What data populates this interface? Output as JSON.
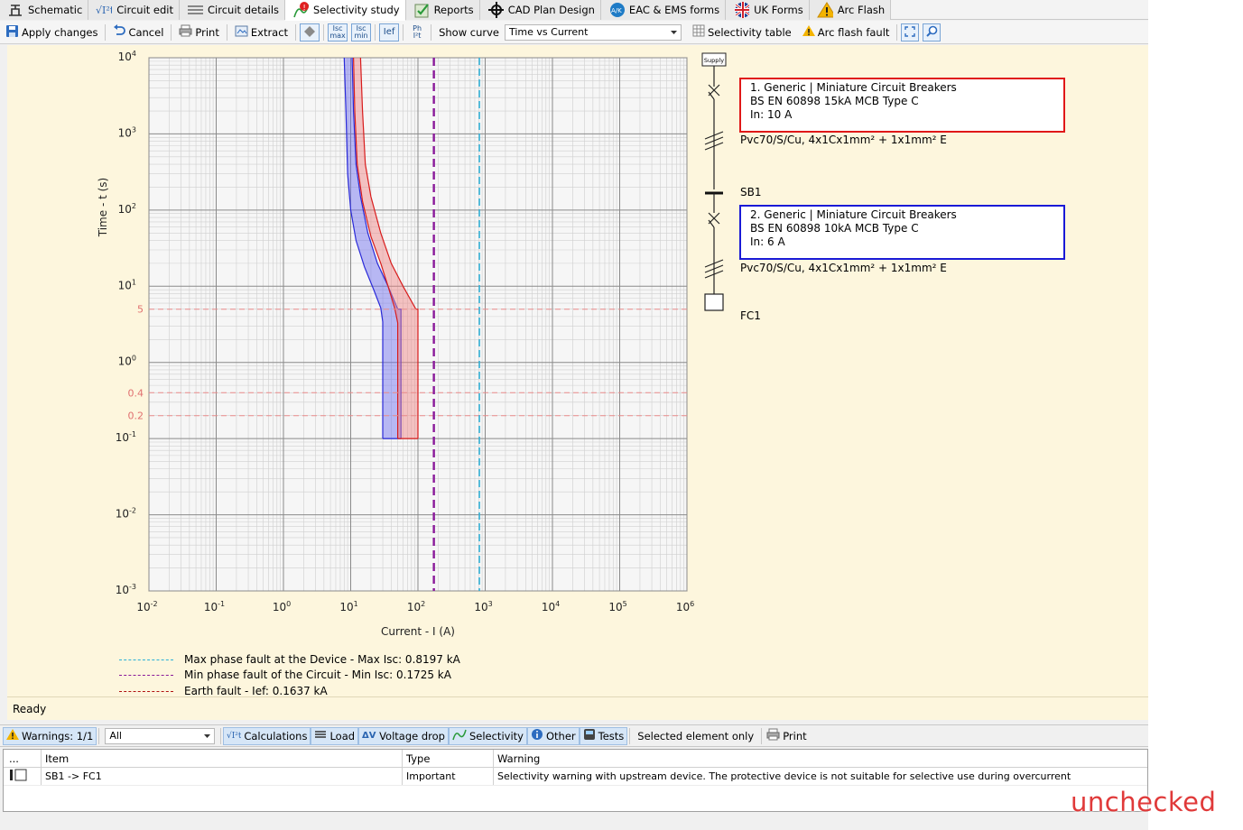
{
  "tabs": [
    {
      "label": "Schematic",
      "icon": "schematic-icon",
      "active": false
    },
    {
      "label": "Circuit edit",
      "icon": "formula-icon",
      "active": false
    },
    {
      "label": "Circuit details",
      "icon": "lines-icon",
      "active": false
    },
    {
      "label": "Selectivity study",
      "icon": "warning-badge-icon",
      "active": true
    },
    {
      "label": "Reports",
      "icon": "checked-doc-icon",
      "active": false
    },
    {
      "label": "CAD Plan Design",
      "icon": "crosshair-icon",
      "active": false
    },
    {
      "label": "EAC & EMS forms",
      "icon": "globe-icon",
      "active": false
    },
    {
      "label": "UK Forms",
      "icon": "uk-flag-icon",
      "active": false
    },
    {
      "label": "Arc Flash",
      "icon": "arc-warning-icon",
      "active": false
    }
  ],
  "toolbar": {
    "apply": "Apply changes",
    "cancel": "Cancel",
    "print": "Print",
    "extract": "Extract",
    "isc_max_top": "Isc",
    "isc_max_bottom": "max",
    "isc_min_top": "Isc",
    "isc_min_bottom": "min",
    "ief": "Ief",
    "ph_top": "Ph",
    "ph_bottom": "I²t",
    "show_curve_label": "Show curve",
    "show_curve_value": "Time vs Current",
    "selectivity_table": "Selectivity table",
    "arc_flash_fault": "Arc flash fault"
  },
  "chart_data": {
    "type": "line",
    "x_scale": "log",
    "y_scale": "log",
    "xlim": [
      0.01,
      1000000
    ],
    "ylim": [
      0.001,
      10000
    ],
    "xlabel": "Current - I (A)",
    "ylabel": "Time - t (s)",
    "x_ticks": [
      {
        "base": "10",
        "exp": "-2"
      },
      {
        "base": "10",
        "exp": "-1"
      },
      {
        "base": "10",
        "exp": "0"
      },
      {
        "base": "10",
        "exp": "1"
      },
      {
        "base": "10",
        "exp": "2"
      },
      {
        "base": "10",
        "exp": "3"
      },
      {
        "base": "10",
        "exp": "4"
      },
      {
        "base": "10",
        "exp": "5"
      },
      {
        "base": "10",
        "exp": "6"
      }
    ],
    "y_ticks": [
      {
        "base": "10",
        "exp": "4"
      },
      {
        "base": "10",
        "exp": "3"
      },
      {
        "base": "10",
        "exp": "2"
      },
      {
        "base": "10",
        "exp": "1"
      },
      {
        "base": "10",
        "exp": "0"
      },
      {
        "base": "10",
        "exp": "-1"
      },
      {
        "base": "10",
        "exp": "-2"
      },
      {
        "base": "10",
        "exp": "-3"
      }
    ],
    "time_markers": [
      {
        "value": 5,
        "label": "5"
      },
      {
        "value": 0.4,
        "label": "0.4"
      },
      {
        "value": 0.2,
        "label": "0.2"
      }
    ],
    "vertical_markers": [
      {
        "name": "Max phase fault at the Device",
        "value": 819.7,
        "color": "#2bb0d8"
      },
      {
        "name": "Min phase fault of the Circuit",
        "value": 172.5,
        "color": "#8a1a9a"
      },
      {
        "name": "Earth fault",
        "value": 163.7,
        "color": "#b01010"
      }
    ],
    "series": [
      {
        "name": "",
        "color": "#2a2ad8",
        "fill": "#6b6bf0",
        "left": [
          [
            8,
            10000
          ],
          [
            8.5,
            2000
          ],
          [
            9,
            300
          ],
          [
            10,
            100
          ],
          [
            12,
            40
          ],
          [
            16,
            18
          ],
          [
            22,
            9
          ],
          [
            28,
            5.2
          ],
          [
            30,
            3.4
          ],
          [
            30,
            0.1
          ]
        ],
        "right": [
          [
            10.5,
            10000
          ],
          [
            11,
            2000
          ],
          [
            12,
            400
          ],
          [
            14,
            150
          ],
          [
            18,
            50
          ],
          [
            25,
            20
          ],
          [
            36,
            10
          ],
          [
            50,
            5
          ],
          [
            56,
            5
          ],
          [
            56,
            0.1
          ]
        ]
      },
      {
        "name": "",
        "color": "#d81c1c",
        "fill": "#f08080",
        "left": [
          [
            11,
            10000
          ],
          [
            11.5,
            2000
          ],
          [
            12.5,
            400
          ],
          [
            15,
            130
          ],
          [
            20,
            45
          ],
          [
            28,
            20
          ],
          [
            36,
            10
          ],
          [
            45,
            5.2
          ],
          [
            50,
            3.3
          ],
          [
            50,
            0.1
          ]
        ],
        "right": [
          [
            14,
            10000
          ],
          [
            15,
            2000
          ],
          [
            16.5,
            400
          ],
          [
            20,
            150
          ],
          [
            28,
            50
          ],
          [
            40,
            20
          ],
          [
            60,
            10
          ],
          [
            93,
            5
          ],
          [
            100,
            5
          ],
          [
            100,
            0.1
          ]
        ]
      }
    ],
    "legend_texts": [
      "Max phase fault at the Device - Max Isc: 0.8197 kA",
      "Min phase fault of the Circuit - Min Isc: 0.1725 kA",
      "Earth fault - Ief: 0.1637 kA"
    ]
  },
  "sld": {
    "supply": "Supply",
    "device1_line1": "1. Generic | Miniature Circuit Breakers",
    "device1_line2": "BS EN 60898 15kA MCB Type C",
    "device1_line3": "In: 10 A",
    "cable1": "Pvc70/S/Cu, 4x1Cx1mm² + 1x1mm² E",
    "busbar": "SB1",
    "device2_line1": "2. Generic | Miniature Circuit Breakers",
    "device2_line2": "BS EN 60898 10kA MCB Type C",
    "device2_line3": "In: 6 A",
    "cable2": "Pvc70/S/Cu, 4x1Cx1mm² + 1x1mm² E",
    "final_circuit": "FC1",
    "device1_color": "#e01818",
    "device2_color": "#1a1ad6"
  },
  "status": "Ready",
  "bottom_toolbar": {
    "warnings": "Warnings: 1/1",
    "filter": "All",
    "calculations": "Calculations",
    "load": "Load",
    "voltage_drop": "Voltage drop",
    "selectivity": "Selectivity",
    "other": "Other",
    "tests": "Tests",
    "selected_only": "Selected element only",
    "print": "Print"
  },
  "warnings_table": {
    "headers": [
      "...",
      "Item",
      "Type",
      "Warning"
    ],
    "rows": [
      {
        "item": "SB1 -> FC1",
        "type": "Important",
        "warning": "Selectivity warning with upstream device. The protective device is not suitable for selective use during overcurrent"
      }
    ]
  },
  "stamp": "unchecked"
}
